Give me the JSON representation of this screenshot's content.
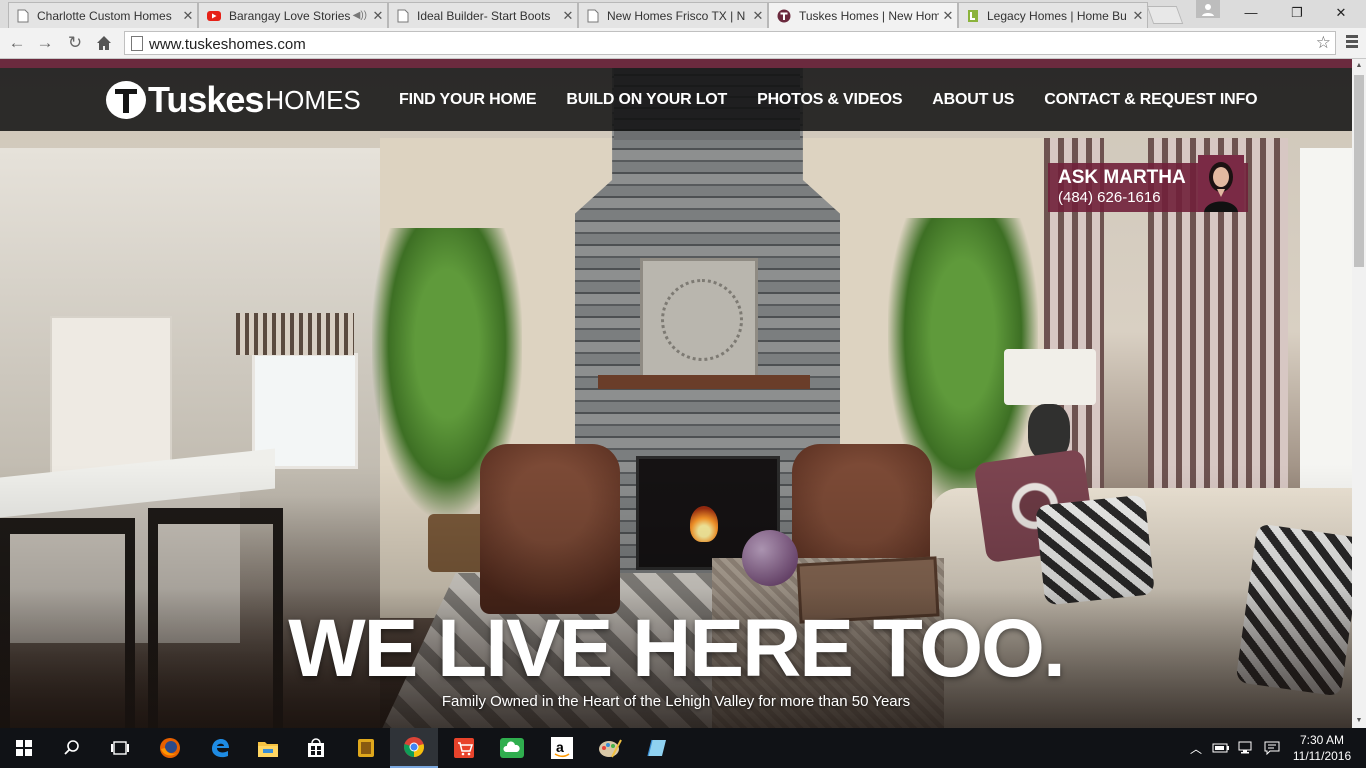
{
  "browser": {
    "tabs": [
      {
        "title": "Charlotte Custom Homes",
        "favicon": "page-icon",
        "active": false
      },
      {
        "title": "Barangay Love Stories",
        "favicon": "youtube-icon",
        "active": false,
        "audio": true
      },
      {
        "title": "Ideal Builder- Start Boots",
        "favicon": "page-icon",
        "active": false
      },
      {
        "title": "New Homes Frisco TX | N",
        "favicon": "page-icon",
        "active": false
      },
      {
        "title": "Tuskes Homes | New Hom",
        "favicon": "tuskes-icon",
        "active": true
      },
      {
        "title": "Legacy Homes | Home Bu",
        "favicon": "legacy-icon",
        "active": false
      }
    ],
    "url": "www.tuskeshomes.com"
  },
  "site": {
    "logo_main": "Tuskes",
    "logo_sub": "HOMES",
    "nav": [
      "FIND YOUR HOME",
      "BUILD ON YOUR LOT",
      "PHOTOS & VIDEOS",
      "ABOUT US",
      "CONTACT & REQUEST INFO"
    ],
    "ask": {
      "name": "ASK MARTHA",
      "phone": "(484) 626-1616"
    },
    "headline": "WE LIVE HERE TOO.",
    "subheadline": "Family Owned in the Heart of the Lehigh Valley for more than 50 Years",
    "accent_color": "#6b2a3e",
    "ask_color": "#70203a"
  },
  "taskbar": {
    "apps": [
      "start-icon",
      "search-icon",
      "task-view-icon",
      "firefox-icon",
      "edge-icon",
      "file-explorer-icon",
      "store-icon",
      "app-icon",
      "chrome-icon",
      "shopping-icon",
      "cloud-icon",
      "amazon-icon",
      "paint-icon",
      "notes-icon"
    ],
    "time": "7:30 AM",
    "date": "11/11/2016"
  }
}
